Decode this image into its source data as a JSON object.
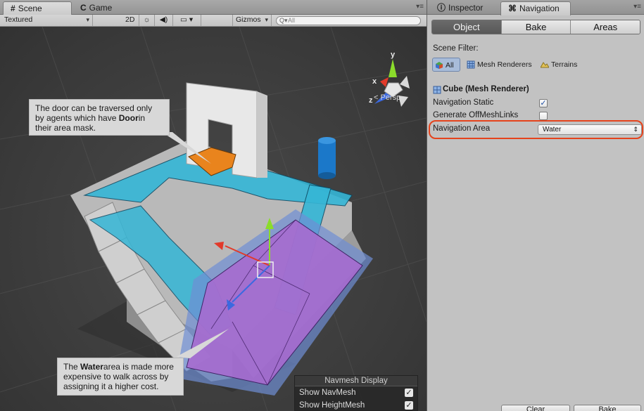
{
  "scene_window": {
    "tabs": [
      {
        "icon": "#",
        "label": "Scene",
        "active": true
      },
      {
        "icon": "C",
        "label": "Game",
        "active": false
      }
    ],
    "toolbar": {
      "shading_mode": "Textured",
      "mode_2d": "2D",
      "gizmos_label": "Gizmos",
      "search_placeholder": "All"
    },
    "projection_label": "Persp",
    "gizmo_axes": {
      "y": "y",
      "x": "x",
      "z": "z"
    },
    "callouts": {
      "door_pre": "The door can be traversed only by agents which have ",
      "door_bold": "Door",
      "door_post": "in their area mask.",
      "water_pre": "The ",
      "water_bold": "Water",
      "water_post": "area is made more expensive to walk across by assigning it a higher cost."
    },
    "navmesh_display": {
      "title": "Navmesh Display",
      "rows": [
        {
          "label": "Show NavMesh",
          "checked": true
        },
        {
          "label": "Show HeightMesh",
          "checked": true
        }
      ]
    }
  },
  "inspector_window": {
    "tabs": [
      {
        "icon": "i",
        "label": "Inspector",
        "active": false
      },
      {
        "icon": "nav",
        "label": "Navigation",
        "active": true
      }
    ],
    "segments": [
      {
        "label": "Object",
        "active": true
      },
      {
        "label": "Bake",
        "active": false
      },
      {
        "label": "Areas",
        "active": false
      }
    ],
    "scene_filter_label": "Scene Filter:",
    "filters": [
      {
        "label": "All",
        "selected": true
      },
      {
        "label": "Mesh Renderers",
        "selected": false
      },
      {
        "label": "Terrains",
        "selected": false
      }
    ],
    "object_title": "Cube (Mesh Renderer)",
    "navigation_static_label": "Navigation Static",
    "navigation_static_checked": true,
    "generate_offmesh_label": "Generate OffMeshLinks",
    "generate_offmesh_checked": false,
    "navigation_area_label": "Navigation Area",
    "navigation_area_value": "Water",
    "bottom_buttons": [
      "Clear",
      "Bake"
    ]
  },
  "colors": {
    "navmesh_cyan": "#35b6d6",
    "water_purple": "#a76cd0",
    "door_orange": "#e9841d",
    "highlight_red": "#e5431c"
  }
}
